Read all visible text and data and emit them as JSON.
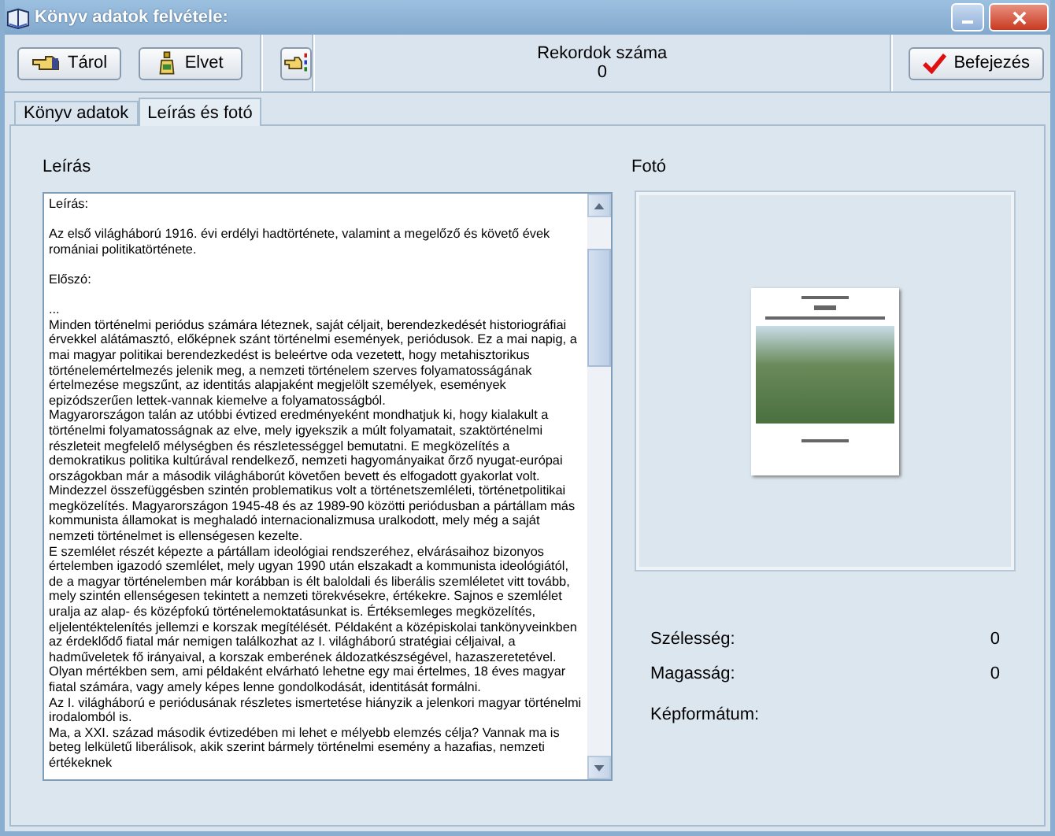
{
  "window": {
    "title": "Könyv adatok felvétele:"
  },
  "toolbar": {
    "buttons": [
      {
        "label": "Tárol",
        "kind": "store"
      },
      {
        "label": "Elvet",
        "kind": "discard"
      },
      {
        "kind": "icon"
      }
    ],
    "record_count_label": "Rekordok száma",
    "record_count": "0",
    "finish_button": "Befejezés"
  },
  "tabs": [
    {
      "label": "Könyv adatok",
      "selected": false
    },
    {
      "label": "Leírás és fotó",
      "selected": true
    }
  ],
  "description": {
    "label": "Leírás",
    "paragraphs": [
      {
        "kind": "heading",
        "text": "Leírás:"
      },
      {
        "kind": "intro",
        "text": " Az első világháború 1916. évi erdélyi hadtörténete, valamint a megelőző és követő évek romániai politikatörténete."
      },
      {
        "kind": "heading",
        "text": "Előszó:"
      },
      {
        "kind": "text",
        "text": " ..."
      },
      {
        "kind": "text",
        "text": "Minden történelmi periódus számára léteznek, saját céljait, berendezkedését historiográfiai érvekkel alátámasztó, előképnek szánt történelmi események, periódusok. Ez a mai napig, a mai magyar politikai berendezkedést is beleértve oda vezetett, hogy metahisztorikus történelemértelmezés jelenik meg, a nemzeti történelem szerves folyamatosságának értelmezése megszűnt, az identitás alapjaként megjelölt személyek, események epizódszerűen lettek-vannak kiemelve a folyamatosságból."
      },
      {
        "kind": "text",
        "text": "Magyarországon talán az utóbbi évtized eredményeként mondhatjuk ki, hogy kialakult a történelmi folyamatosságnak az elve, mely igyekszik a múlt folyamatait, szaktörténelmi részleteit megfelelő mélységben és részletességgel bemutatni. E megközelítés a demokratikus politika kultúrával rendelkező, nemzeti hagyományaikat őrző nyugat-európai országokban már a második világháborút követően bevett és elfogadott gyakorlat volt."
      },
      {
        "kind": "text",
        "text": "Mindezzel összefüggésben szintén problematikus volt a történetszemléleti, történetpolitikai megközelítés. Magyarországon 1945-48 és az 1989-90 közötti periódusban a pártállam más kommunista államokat is meghaladó internacionalizmusa uralkodott, mely még a saját nemzeti történelmet is ellenségesen kezelte."
      },
      {
        "kind": "text",
        "text": "E szemlélet részét képezte a pártállam ideológiai rendszeréhez, elvárásaihoz bizonyos értelemben igazodó szemlélet, mely ugyan 1990 után elszakadt a kommunista ideológiától, de a magyar történelemben már korábban is élt baloldali és liberális szemléletet vitt tovább, mely szintén ellenségesen tekintett a nemzeti törekvésekre, értékekre. Sajnos e szemlélet uralja az alap- és középfokú történelemoktatásunkat is. Értéksemleges megközelítés, eljelentéktelenítés jellemzi e korszak megítélését. Példaként a középiskolai tankönyveinkben az érdeklődő fiatal már nemigen találkozhat az I. világháború stratégiai céljaival, a hadműveletek fő irányaival, a korszak emberének áldozatkészségével, hazaszeretetével. Olyan mértékben sem, ami példaként elvárható lehetne egy mai értelmes, 18 éves magyar fiatal számára, vagy amely képes lenne gondolkodását, identitását formálni."
      },
      {
        "kind": "text",
        "text": "Az I. világháború e periódusának részletes ismertetése hiányzik a jelenkori magyar történelmi irodalomból is."
      },
      {
        "kind": "text",
        "text": "Ma, a XXI. század második évtizedében mi lehet e mélyebb elemzés célja? Vannak ma is beteg lelkületű liberálisok, akik szerint bármely történelmi esemény a hazafias, nemzeti értékeknek"
      }
    ]
  },
  "photo": {
    "label": "Fotó",
    "fields": [
      {
        "label": "Szélesség:",
        "value": "0"
      },
      {
        "label": "Magasság:",
        "value": "0"
      },
      {
        "label": "Képformátum:"
      }
    ]
  }
}
